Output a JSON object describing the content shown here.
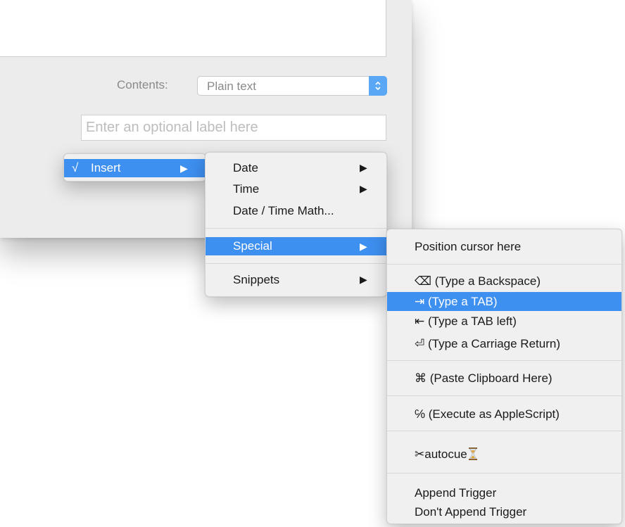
{
  "dialog": {
    "contents_label": "Contents:",
    "contents_value": "Plain text",
    "label_placeholder": "Enter an optional label here"
  },
  "menu_insert": {
    "check": "√",
    "label": "Insert",
    "arrow": "▶"
  },
  "menu_main": {
    "items": [
      {
        "label": "Date",
        "arrow": "▶"
      },
      {
        "label": "Time",
        "arrow": "▶"
      },
      {
        "label": "Date / Time Math..."
      },
      {
        "label": "Special",
        "arrow": "▶"
      },
      {
        "label": "Snippets",
        "arrow": "▶"
      }
    ]
  },
  "menu_special": {
    "items": [
      {
        "label": "Position cursor here"
      },
      {
        "label": "⌫ (Type a Backspace)"
      },
      {
        "label": "⇥ (Type a TAB)"
      },
      {
        "label": "⇤ (Type a TAB left)"
      },
      {
        "label": "⏎ (Type a Carriage Return)"
      },
      {
        "label": "⌘ (Paste Clipboard Here)"
      },
      {
        "label": "℅ (Execute as AppleScript)"
      },
      {
        "label": "✂autocue"
      },
      {
        "label": "Append Trigger"
      },
      {
        "label": "Don't Append Trigger"
      }
    ]
  },
  "colors": {
    "highlight": "#3d8ff0",
    "popup_accent": "#5aa8f5"
  }
}
